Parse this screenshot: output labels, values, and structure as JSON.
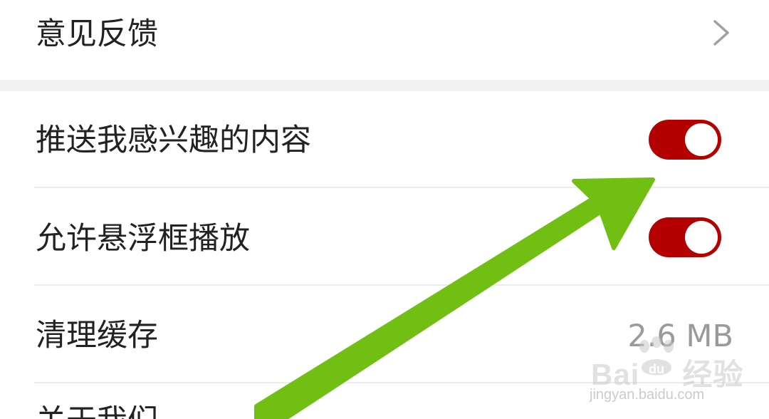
{
  "settings": {
    "feedback": {
      "label": "意见反馈"
    },
    "push_interest": {
      "label": "推送我感兴趣的内容",
      "enabled": true
    },
    "floating_play": {
      "label": "允许悬浮框播放",
      "enabled": true
    },
    "clear_cache": {
      "label": "清理缓存",
      "value": "2.6 MB"
    },
    "next_item": {
      "label": "关于我们"
    }
  },
  "watermark": {
    "brand_left": "Bai",
    "brand_right": "经验",
    "paw_letters": "du",
    "url": "jingyan.baidu.com"
  },
  "icons": {
    "chevron": "chevron-right-icon",
    "annotation": "green-arrow-annotation"
  },
  "colors": {
    "toggle_on": "#b30000",
    "arrow": "#72bf14",
    "gap": "#f2f2f2",
    "text": "#222222",
    "value_text": "#9a9a9a"
  }
}
